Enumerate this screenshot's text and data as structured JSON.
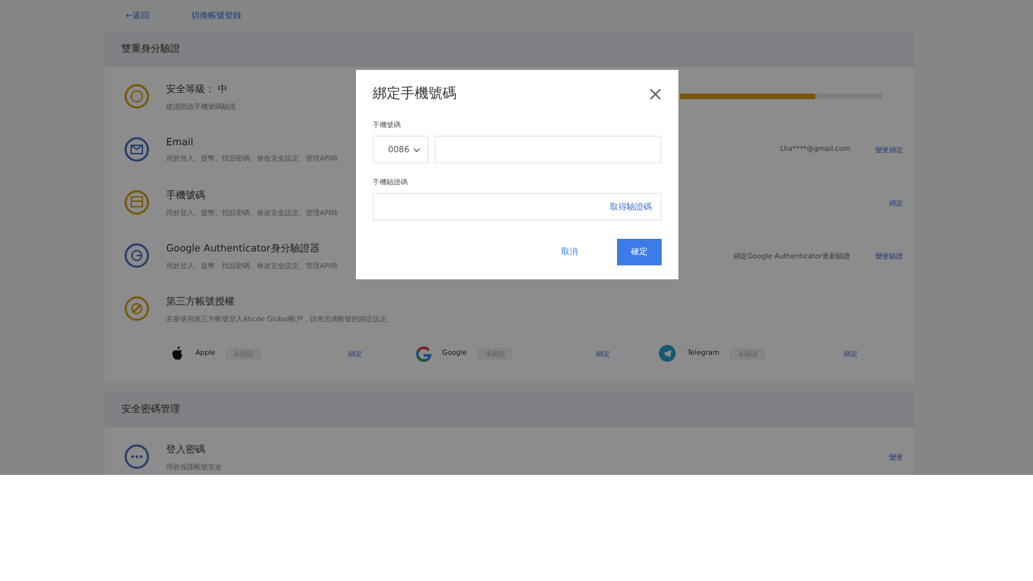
{
  "top_links": [
    "←返回",
    "切換帳號登錄"
  ],
  "two_factor": {
    "title": "雙重身分驗證",
    "security": {
      "label": "安全等級： 中",
      "hint": "建議開啟手機號碼驗證",
      "level": 0.67
    },
    "methods": [
      {
        "kind": "email",
        "title": "Email",
        "desc": "用於登入、提幣、找回密碼、修改安全設定、管理API時",
        "value": "Lha****@gmail.com",
        "action": "變更綁定"
      },
      {
        "kind": "phone",
        "title": "手機號碼",
        "desc": "用於登入、提幣、找回密碼、修改安全設定、管理API時",
        "action": "綁定"
      },
      {
        "kind": "ga",
        "title": "Google Authenticator身分驗證器",
        "desc": "用於登入、提幣、找回密碼、修改安全設定、管理API時",
        "value": "綁定Google Authenticator更新驗證",
        "action": "變更驗證"
      }
    ],
    "third_party": {
      "title": "第三方帳號授權",
      "desc": "若要使用第三方帳號登入Abcde Global帳戶，請先完成帳號的綁定設定。",
      "accounts": [
        {
          "kind": "apple",
          "name": "Apple",
          "status": "未綁定",
          "action": "綁定"
        },
        {
          "kind": "google",
          "name": "Google",
          "status": "未綁定",
          "action": "綁定"
        },
        {
          "kind": "telegram",
          "name": "Telegram",
          "status": "未綁定",
          "action": "綁定"
        }
      ]
    }
  },
  "password_section": {
    "title": "安全密碼管理",
    "rows": [
      {
        "title": "登入密碼",
        "desc": "用於保護帳號安全",
        "action": "變更"
      }
    ]
  },
  "dialog": {
    "title": "綁定手機號碼",
    "phone_label": "手機號碼",
    "country_code": "0086",
    "code_label": "手機驗證碼",
    "get_code": "取得驗證碼",
    "cancel": "取消",
    "confirm": "確定"
  }
}
